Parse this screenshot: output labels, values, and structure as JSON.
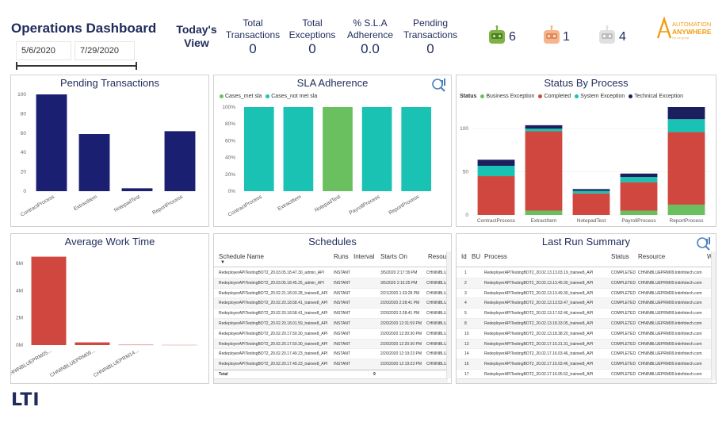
{
  "header": {
    "title": "Operations Dashboard",
    "date_start": "5/6/2020",
    "date_end": "7/29/2020",
    "todays_view": "Today's View",
    "kpis": [
      {
        "label": "Total Transactions",
        "value": "0"
      },
      {
        "label": "Total Exceptions",
        "value": "0"
      },
      {
        "label": "% S.L.A Adherence",
        "value": "0.0"
      },
      {
        "label": "Pending Transactions",
        "value": "0"
      }
    ],
    "bots": [
      {
        "icon": "green-bot-icon",
        "count": "6",
        "color": "#7cb342"
      },
      {
        "icon": "orange-bot-icon",
        "count": "1",
        "color": "#f0a070"
      },
      {
        "icon": "white-bot-icon",
        "count": "4",
        "color": "#d9d9d9"
      }
    ],
    "brand_logo_text": "AUTOMATION ANYWHERE"
  },
  "footer": {
    "logo": "LTI"
  },
  "colors": {
    "navy": "#1a1f71",
    "teal": "#19c2b2",
    "green": "#6abf5e",
    "red": "#d0473f",
    "dark_navy": "#1b1f5e",
    "title": "#1f2b5b"
  },
  "panels": {
    "pending": {
      "title": "Pending Transactions"
    },
    "sla": {
      "title": "SLA Adherence",
      "legend": [
        "Cases_met sla",
        "Cases_not met sla"
      ]
    },
    "status": {
      "title": "Status By Process",
      "legend_title": "Status",
      "legend": [
        "Business Exception",
        "Completed",
        "System Exception",
        "Technical Exception"
      ]
    },
    "awt": {
      "title": "Average Work Time"
    },
    "schedules": {
      "title": "Schedules"
    },
    "lrs": {
      "title": "Last Run Summary"
    }
  },
  "chart_data": [
    {
      "type": "bar",
      "title": "Pending Transactions",
      "categories": [
        "ContractProcess",
        "ExtractItem",
        "NotepadTest",
        "ReportProcess"
      ],
      "values": [
        100,
        59,
        3,
        62
      ],
      "ylim": [
        0,
        100
      ],
      "yticks": [
        "0",
        "20",
        "40",
        "60",
        "80",
        "100"
      ]
    },
    {
      "type": "bar",
      "title": "SLA Adherence",
      "categories": [
        "ContractProcess",
        "ExtractItem",
        "NotepadTest",
        "PayrollProcess",
        "ReportProcess"
      ],
      "series": [
        {
          "name": "Cases_met sla",
          "values": [
            100,
            100,
            0,
            100,
            100
          ]
        },
        {
          "name": "Cases_not met sla",
          "values": [
            0,
            0,
            100,
            0,
            0
          ]
        }
      ],
      "ylim": [
        0,
        100
      ],
      "yticks": [
        "0%",
        "20%",
        "40%",
        "60%",
        "80%",
        "100%"
      ]
    },
    {
      "type": "bar",
      "stacked": true,
      "title": "Status By Process",
      "categories": [
        "ContractProcess",
        "ExtractItem",
        "NotepadTest",
        "PayrollProcess",
        "ReportProcess"
      ],
      "series": [
        {
          "name": "Business Exception",
          "values": [
            0,
            5,
            0,
            5,
            12
          ]
        },
        {
          "name": "Completed",
          "values": [
            45,
            92,
            25,
            33,
            84
          ]
        },
        {
          "name": "System Exception",
          "values": [
            12,
            3,
            3,
            6,
            15
          ]
        },
        {
          "name": "Technical Exception",
          "values": [
            7,
            4,
            2,
            4,
            14
          ]
        }
      ],
      "ylim": [
        0,
        125
      ],
      "yticks": [
        "0",
        "50",
        "100"
      ]
    },
    {
      "type": "bar",
      "title": "Average Work Time",
      "categories": [
        "CHNINBLUEPRM05...",
        "CHNINBLUEPRM09...",
        "CHNINBLUEPRM14...",
        ""
      ],
      "values": [
        6500000,
        200000,
        50000,
        30000
      ],
      "ylim": [
        0,
        7000000
      ],
      "yticks": [
        "0M",
        "2M",
        "4M",
        "6M"
      ]
    }
  ],
  "schedules": {
    "columns": [
      "Schedule Name",
      "Runs",
      "Interval",
      "Starts On",
      "Resou"
    ],
    "rows": [
      [
        "RedeployerAPITestingBOT2_20.03.05.18.47.30_admin_API",
        "INSTANT",
        "",
        "3/5/2020 2:17:39 PM",
        "CHNINBLU"
      ],
      [
        "RedeployerAPITestingBOT2_20.03.05.18.45.25_admin_API",
        "INSTANT",
        "",
        "3/5/2020 2:15:25 PM",
        "CHNINBLU"
      ],
      [
        "RedeployerAPITestingBOT2_20.02.21.18.03.28_trainee8_API",
        "INSTANT",
        "",
        "2/21/2020 1:33:28 PM",
        "CHNINBLU"
      ],
      [
        "RedeployerAPITestingBOT2_20.02.20.18.58.41_trainee8_API",
        "INSTANT",
        "",
        "2/20/2020 2:28:41 PM",
        "CHNINBLU"
      ],
      [
        "RedeployerAPITestingBOT2_20.02.20.18.58.41_trainee8_API",
        "INSTANT",
        "",
        "2/20/2020 2:28:41 PM",
        "CHNINBLU"
      ],
      [
        "RedeployerAPITestingBOT2_20.02.20.18.01.59_trainee8_API",
        "INSTANT",
        "",
        "2/20/2020 12:31:59 PM",
        "CHNINBLU"
      ],
      [
        "RedeployerAPITestingBOT2_20.02.20.17.50.30_trainee8_API",
        "INSTANT",
        "",
        "2/20/2020 12:20:30 PM",
        "CHNINBLU"
      ],
      [
        "RedeployerAPITestingBOT2_20.02.20.17.50.30_trainee8_API",
        "INSTANT",
        "",
        "2/20/2020 12:20:30 PM",
        "CHNINBLU"
      ],
      [
        "RedeployerAPITestingBOT2_20.02.20.17.49.23_trainee8_API",
        "INSTANT",
        "",
        "2/20/2020 12:19:23 PM",
        "CHNINBLU"
      ],
      [
        "RedeployerAPITestingBOT2_20.02.20.17.49.23_trainee8_API",
        "INSTANT",
        "",
        "2/20/2020 12:19:23 PM",
        "CHNINBLU"
      ]
    ],
    "total_label": "Total",
    "total_runs": "9"
  },
  "last_run_summary": {
    "columns": [
      "Id",
      "BU",
      "Process",
      "Status",
      "Resource",
      "W"
    ],
    "rows": [
      [
        "1",
        "",
        "RedeployerAPITestingBOT2_20.02.13.13.03.19_trainee8_API",
        "COMPLETED",
        "CHNINBLUEPRM09.lntinfotech.com"
      ],
      [
        "2",
        "",
        "RedeployerAPITestingBOT2_20.02.13.13.45.00_trainee8_API",
        "COMPLETED",
        "CHNINBLUEPRM09.lntinfotech.com"
      ],
      [
        "3",
        "",
        "RedeployerAPITestingBOT2_20.02.13.13.49.30_trainee8_API",
        "COMPLETED",
        "CHNINBLUEPRM09.lntinfotech.com"
      ],
      [
        "4",
        "",
        "RedeployerAPITestingBOT2_20.02.13.13.53.47_trainee8_API",
        "COMPLETED",
        "CHNINBLUEPRM09.lntinfotech.com"
      ],
      [
        "5",
        "",
        "RedeployerAPITestingBOT2_20.02.13.17.52.46_trainee8_API",
        "COMPLETED",
        "CHNINBLUEPRM09.lntinfotech.com"
      ],
      [
        "8",
        "",
        "RedeployerAPITestingBOT2_20.02.13.18.33.05_trainee8_API",
        "COMPLETED",
        "CHNINBLUEPRM09.lntinfotech.com"
      ],
      [
        "10",
        "",
        "RedeployerAPITestingBOT2_20.02.13.18.38.20_trainee8_API",
        "COMPLETED",
        "CHNINBLUEPRM09.lntinfotech.com"
      ],
      [
        "13",
        "",
        "RedeployerAPITestingBOT2_20.02.17.15.21.31_trainee8_API",
        "COMPLETED",
        "CHNINBLUEPRM09.lntinfotech.com"
      ],
      [
        "14",
        "",
        "RedeployerAPITestingBOT2_20.02.17.16.03.46_trainee8_API",
        "COMPLETED",
        "CHNINBLUEPRM09.lntinfotech.com"
      ],
      [
        "16",
        "",
        "RedeployerAPITestingBOT2_20.02.17.16.03.46_trainee8_API",
        "COMPLETED",
        "CHNINBLUEPRM09.lntinfotech.com"
      ],
      [
        "17",
        "",
        "RedeployerAPITestingBOT2_20.02.17.16.05.52_trainee8_API",
        "COMPLETED",
        "CHNINBLUEPRM09.lntinfotech.com"
      ]
    ]
  }
}
